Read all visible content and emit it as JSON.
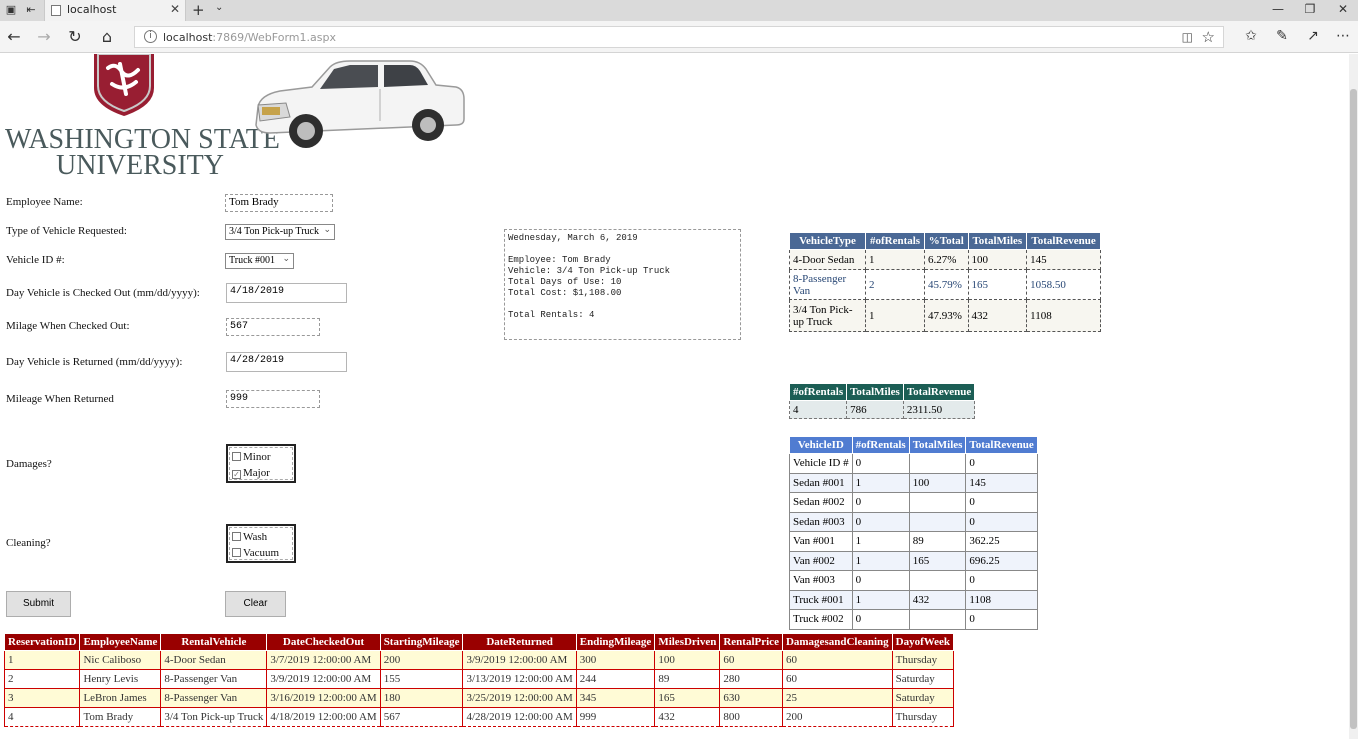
{
  "browser": {
    "tab_title": "localhost",
    "url_host": "localhost",
    "url_path": ":7869/WebForm1.aspx",
    "info_glyph": "i"
  },
  "branding": {
    "university_line1": "WASHINGTON STATE",
    "university_line2": "UNIVERSITY",
    "shield_color": "#981e32"
  },
  "form": {
    "employee_label": "Employee Name:",
    "employee_value": "Tom Brady",
    "vehicle_type_label": "Type of Vehicle Requested:",
    "vehicle_type_value": "3/4 Ton Pick-up Truck",
    "vehicle_id_label": "Vehicle ID #:",
    "vehicle_id_value": "Truck #001",
    "checkout_label": "Day Vehicle is Checked Out (mm/dd/yyyy):",
    "checkout_value": "4/18/2019",
    "milage_out_label": "Milage When Checked Out:",
    "milage_out_value": "567",
    "return_label": "Day Vehicle is Returned (mm/dd/yyyy):",
    "return_value": "4/28/2019",
    "mileage_return_label": "Mileage When Returned",
    "mileage_return_value": "999",
    "damages_label": "Damages?",
    "damages_options": [
      {
        "label": "Minor",
        "checked": false
      },
      {
        "label": "Major",
        "checked": true
      }
    ],
    "cleaning_label": "Cleaning?",
    "cleaning_options": [
      {
        "label": "Wash",
        "checked": false
      },
      {
        "label": "Vacuum",
        "checked": false
      }
    ],
    "submit_label": "Submit",
    "clear_label": "Clear"
  },
  "summary": {
    "date": "Wednesday, March 6, 2019",
    "employee": "Employee: Tom Brady",
    "vehicle": "Vehicle: 3/4 Ton Pick-up Truck",
    "days": "Total Days of Use: 10",
    "cost": "Total Cost: $1,108.00",
    "rentals": "Total Rentals: 4"
  },
  "type_table": {
    "headers": [
      "VehicleType",
      "#ofRentals",
      "%Total",
      "TotalMiles",
      "TotalRevenue"
    ],
    "rows": [
      [
        "4-Door Sedan",
        "1",
        "6.27%",
        "100",
        "145"
      ],
      [
        "8-Passenger Van",
        "2",
        "45.79%",
        "165",
        "1058.50"
      ],
      [
        "3/4 Ton Pick-up Truck",
        "1",
        "47.93%",
        "432",
        "1108"
      ]
    ]
  },
  "totals_table": {
    "headers": [
      "#ofRentals",
      "TotalMiles",
      "TotalRevenue"
    ],
    "rows": [
      [
        "4",
        "786",
        "2311.50"
      ]
    ]
  },
  "vehicle_table": {
    "headers": [
      "VehicleID",
      "#ofRentals",
      "TotalMiles",
      "TotalRevenue"
    ],
    "rows": [
      [
        "Vehicle ID #",
        "0",
        "",
        "0"
      ],
      [
        "Sedan #001",
        "1",
        "100",
        "145"
      ],
      [
        "Sedan #002",
        "0",
        "",
        "0"
      ],
      [
        "Sedan #003",
        "0",
        "",
        "0"
      ],
      [
        "Van #001",
        "1",
        "89",
        "362.25"
      ],
      [
        "Van #002",
        "1",
        "165",
        "696.25"
      ],
      [
        "Van #003",
        "0",
        "",
        "0"
      ],
      [
        "Truck #001",
        "1",
        "432",
        "1108"
      ],
      [
        "Truck #002",
        "0",
        "",
        "0"
      ]
    ]
  },
  "reservations_table": {
    "headers": [
      "ReservationID",
      "EmployeeName",
      "RentalVehicle",
      "DateCheckedOut",
      "StartingMileage",
      "DateReturned",
      "EndingMileage",
      "MilesDriven",
      "RentalPrice",
      "DamagesandCleaning",
      "DayofWeek"
    ],
    "rows": [
      [
        "1",
        "Nic Caliboso",
        "4-Door Sedan",
        "3/7/2019 12:00:00 AM",
        "200",
        "3/9/2019 12:00:00 AM",
        "300",
        "100",
        "60",
        "60",
        "Thursday"
      ],
      [
        "2",
        "Henry Levis",
        "8-Passenger Van",
        "3/9/2019 12:00:00 AM",
        "155",
        "3/13/2019 12:00:00 AM",
        "244",
        "89",
        "280",
        "60",
        "Saturday"
      ],
      [
        "3",
        "LeBron James",
        "8-Passenger Van",
        "3/16/2019 12:00:00 AM",
        "180",
        "3/25/2019 12:00:00 AM",
        "345",
        "165",
        "630",
        "25",
        "Saturday"
      ],
      [
        "4",
        "Tom Brady",
        "3/4 Ton Pick-up Truck",
        "4/18/2019 12:00:00 AM",
        "567",
        "4/28/2019 12:00:00 AM",
        "999",
        "432",
        "800",
        "200",
        "Thursday"
      ]
    ]
  }
}
